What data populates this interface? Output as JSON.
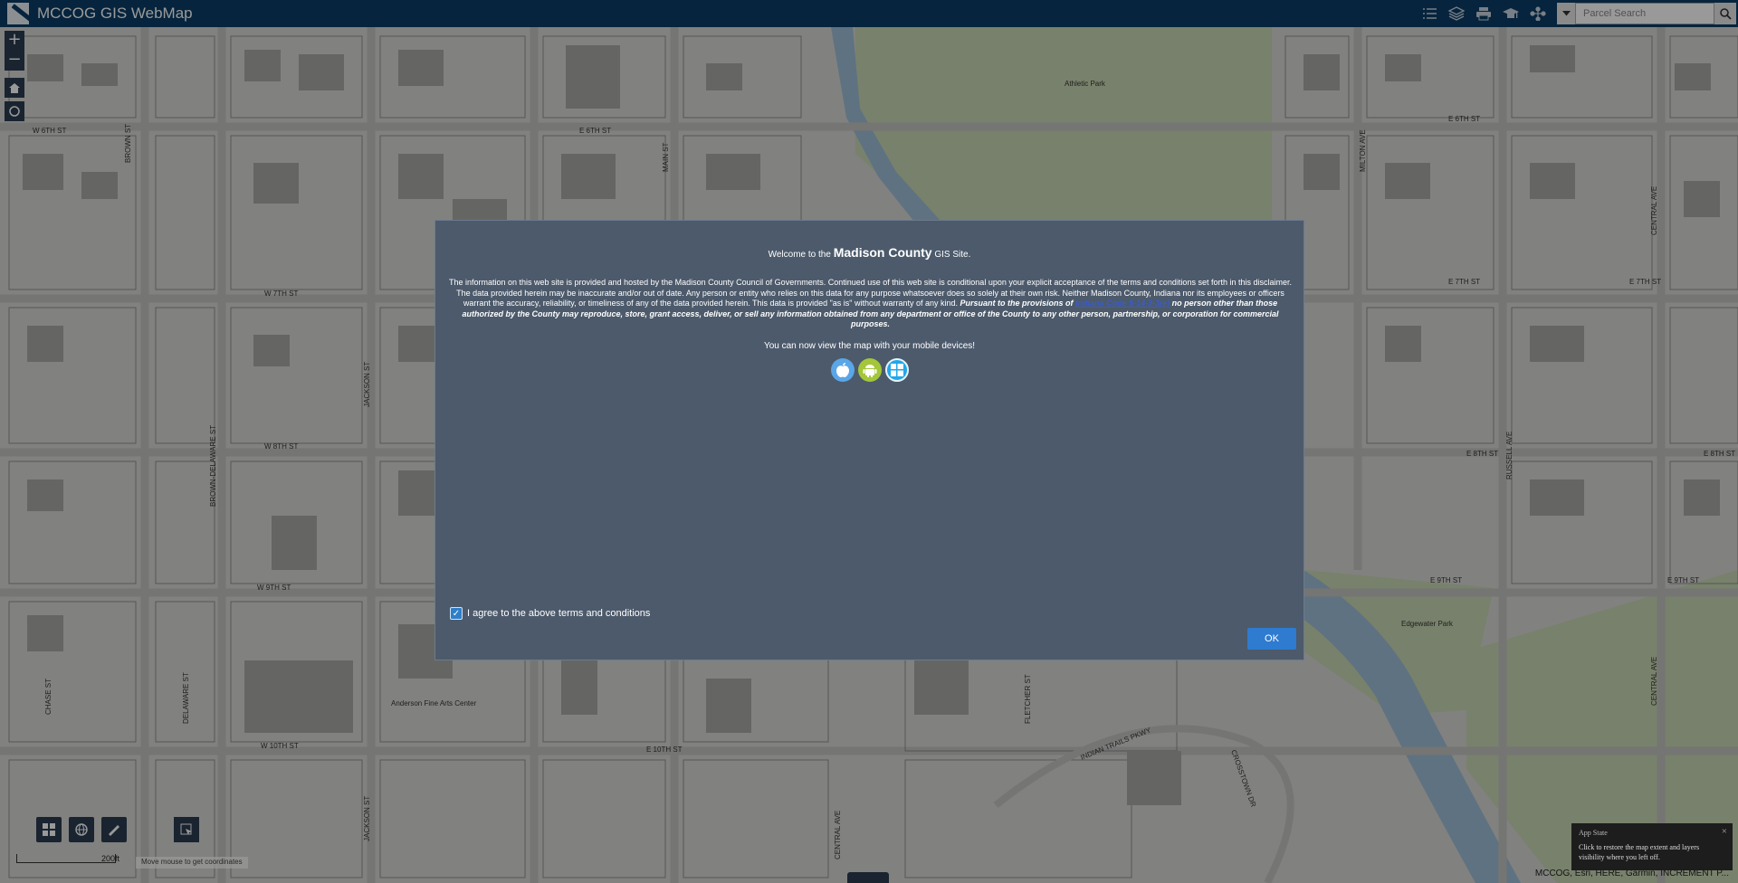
{
  "header": {
    "title": "MCCOG GIS WebMap",
    "tools": [
      "legend-icon",
      "layers-icon",
      "print-icon",
      "education-icon",
      "share-icon"
    ],
    "search_placeholder": "Parcel Search"
  },
  "map": {
    "street_labels": [
      "W 6TH ST",
      "E 6TH ST",
      "W 7TH ST",
      "W 8TH ST",
      "W 9TH ST",
      "W 10TH ST",
      "E 10TH ST",
      "E 6TH ST",
      "E 7TH ST",
      "E 7TH ST",
      "E 8TH ST",
      "E 8TH ST",
      "E 9TH ST",
      "E 9TH ST",
      "BROWN ST",
      "JACKSON ST",
      "JACKSON ST",
      "MAIN ST",
      "MILTON AVE",
      "CENTRAL AVE",
      "CENTRAL AVE",
      "CENTRAL AVE",
      "RUSSELL AVE",
      "BROWN-DELAWARE ST",
      "DELAWARE ST",
      "CHASE ST",
      "INDIAN TRAILS PKWY",
      "CROSSTOWN DR",
      "FLETCHER ST"
    ],
    "place_labels": [
      "Athletic Park",
      "Edgewater Park",
      "Anderson Fine Arts Center"
    ],
    "scale_label": "200ft",
    "coordinates_hint": "Move mouse to get coordinates",
    "attribution": "MCCOG, Esri, HERE, Garmin, INCREMENT P..."
  },
  "app_state": {
    "title": "App State",
    "message": "Click to restore the map extent and layers visibility where you left off."
  },
  "modal": {
    "welcome_prefix": "Welcome to the ",
    "county": "Madison County",
    "welcome_suffix": " GIS Site.",
    "disclaimer_plain": "The information on this web site is provided and hosted by the Madison County Council of Governments. Continued use of this web site is conditional upon your explicit acceptance of the terms and conditions set forth in this disclaimer. The data provided herein may be inaccurate and/or out of date. Any person or entity who relies on this data for any purpose whatsoever does so solely at their own risk. Neither Madison County, Indiana nor its employees or officers warrant the accuracy, reliability, or timeliness of any of the data provided herein. This data is provided \"as is\" without warranty of any kind. ",
    "disclaimer_legal_prefix": "Pursuant to the provisions of ",
    "code_link": "Indiana Code 5-14-3-3(e)",
    "disclaimer_legal_suffix": " no person other than those authorized by the County may reproduce, store, grant access, deliver, or sell any information obtained from any department or office of the County to any other person, partnership, or corporation for commercial purposes.",
    "mobile_text": "You can now view the map with your mobile devices!",
    "store_icons": [
      "apple-icon",
      "android-icon",
      "windows-icon"
    ],
    "agree_label": "I agree to the above terms and conditions",
    "agree_checked": true,
    "ok_label": "OK"
  }
}
